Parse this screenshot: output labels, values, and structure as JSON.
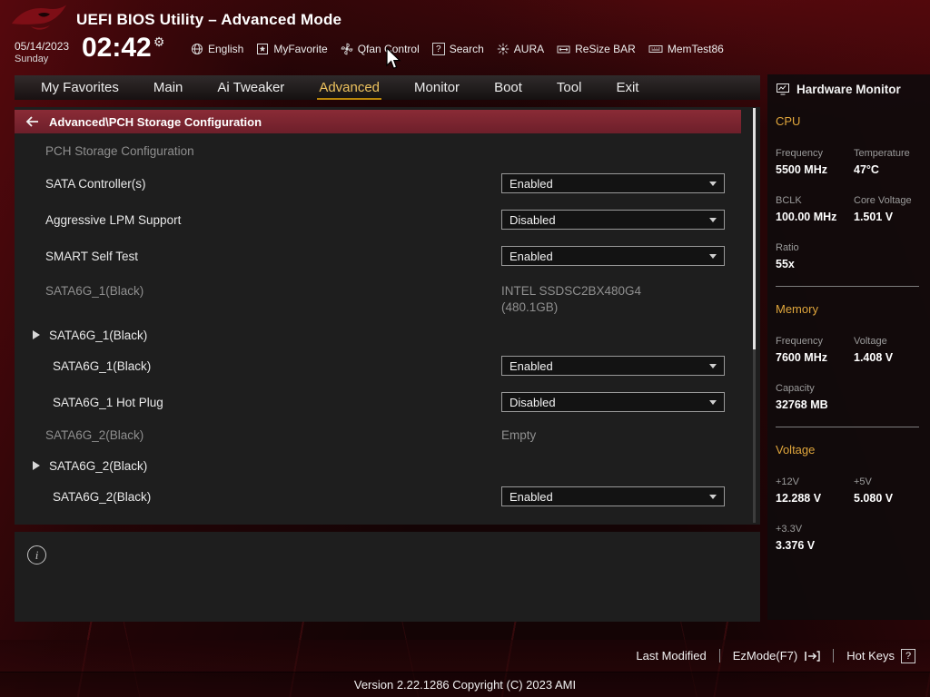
{
  "colors": {
    "accent_gold": "#e0a63c",
    "maroon_bar": "#7c2430",
    "panel_bg": "#1e1e1e"
  },
  "header": {
    "title": "UEFI BIOS Utility – Advanced Mode",
    "date": "05/14/2023",
    "day": "Sunday",
    "time": "02:42",
    "time_gear_icon": "⚙",
    "toolbar": [
      {
        "label": "English",
        "icon": "globe-icon"
      },
      {
        "label": "MyFavorite",
        "icon": "favorite-icon"
      },
      {
        "label": "Qfan Control",
        "icon": "fan-icon"
      },
      {
        "label": "Search",
        "icon": "search-icon"
      },
      {
        "label": "AURA",
        "icon": "aura-icon"
      },
      {
        "label": "ReSize BAR",
        "icon": "resize-bar-icon"
      },
      {
        "label": "MemTest86",
        "icon": "memtest-icon"
      }
    ]
  },
  "nav": {
    "tabs": [
      {
        "label": "My Favorites",
        "active": false
      },
      {
        "label": "Main",
        "active": false
      },
      {
        "label": "Ai Tweaker",
        "active": false
      },
      {
        "label": "Advanced",
        "active": true
      },
      {
        "label": "Monitor",
        "active": false
      },
      {
        "label": "Boot",
        "active": false
      },
      {
        "label": "Tool",
        "active": false
      },
      {
        "label": "Exit",
        "active": false
      }
    ]
  },
  "content": {
    "breadcrumb": "Advanced\\PCH Storage Configuration",
    "section_title": "PCH Storage Configuration",
    "rows": [
      {
        "type": "dropdown",
        "label": "SATA Controller(s)",
        "value": "Enabled"
      },
      {
        "type": "dropdown",
        "label": "Aggressive LPM Support",
        "value": "Disabled"
      },
      {
        "type": "dropdown",
        "label": "SMART Self Test",
        "value": "Enabled"
      },
      {
        "type": "info",
        "label": "SATA6G_1(Black)",
        "value": "INTEL SSDSC2BX480G4",
        "value2": "(480.1GB)"
      },
      {
        "type": "expand",
        "label": "SATA6G_1(Black)"
      },
      {
        "type": "dropdown",
        "label": "SATA6G_1(Black)",
        "value": "Enabled"
      },
      {
        "type": "dropdown",
        "label": "SATA6G_1 Hot Plug",
        "value": "Disabled"
      },
      {
        "type": "info",
        "label": "SATA6G_2(Black)",
        "value": "Empty"
      },
      {
        "type": "expand",
        "label": "SATA6G_2(Black)"
      },
      {
        "type": "dropdown",
        "label": "SATA6G_2(Black)",
        "value": "Enabled"
      }
    ]
  },
  "hardware_monitor": {
    "title": "Hardware Monitor",
    "sections": [
      {
        "title": "CPU",
        "items": [
          {
            "label": "Frequency",
            "value": "5500 MHz"
          },
          {
            "label": "Temperature",
            "value": "47°C"
          },
          {
            "label": "BCLK",
            "value": "100.00 MHz"
          },
          {
            "label": "Core Voltage",
            "value": "1.501 V"
          },
          {
            "label": "Ratio",
            "value": "55x"
          }
        ]
      },
      {
        "title": "Memory",
        "items": [
          {
            "label": "Frequency",
            "value": "7600 MHz"
          },
          {
            "label": "Voltage",
            "value": "1.408 V"
          },
          {
            "label": "Capacity",
            "value": "32768 MB"
          }
        ]
      },
      {
        "title": "Voltage",
        "items": [
          {
            "label": "+12V",
            "value": "12.288 V"
          },
          {
            "label": "+5V",
            "value": "5.080 V"
          },
          {
            "label": "+3.3V",
            "value": "3.376 V"
          }
        ]
      }
    ]
  },
  "footer": {
    "last_modified": "Last Modified",
    "ezmode": "EzMode(F7)",
    "hot_keys": "Hot Keys",
    "hot_keys_icon": "?",
    "version": "Version 2.22.1286 Copyright (C) 2023 AMI"
  }
}
